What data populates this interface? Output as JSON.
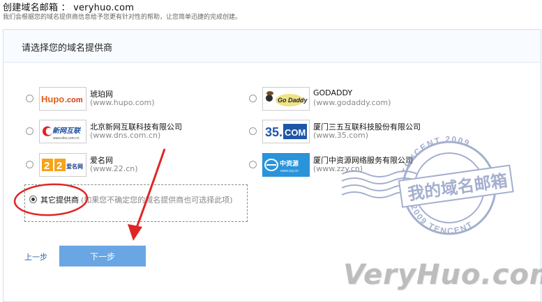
{
  "header": {
    "title": "创建域名邮箱 ： veryhuo.com",
    "subtitle": "我们会根据您的域名提供商信息给予您更有针对性的帮助，让您简单迅捷的完成创建。"
  },
  "panel": {
    "title": "请选择您的域名提供商"
  },
  "providers": [
    {
      "name": "琥珀网",
      "url": "(www.hupo.com)",
      "logo_text": "Hupo.com"
    },
    {
      "name": "GODADDY",
      "url": "(www.godaddy.com)",
      "logo_text": "Go Daddy"
    },
    {
      "name": "北京新网互联科技有限公司",
      "url": "(www.dns.com.cn)",
      "logo_text": "新网互联",
      "logo_sub": "www.dns.com.cn"
    },
    {
      "name": "厦门三五互联科技股份有限公司",
      "url": "(www.35.com)",
      "logo_text": "35.COM"
    },
    {
      "name": "爱名网",
      "url": "(www.22.cn)",
      "logo_text": "22",
      "logo_sub": "爱名网"
    },
    {
      "name": "厦门中资源网络服务有限公司",
      "url": "(www.zzy.cn)",
      "logo_text": "中资源",
      "logo_sub": "www.zzy.cn"
    }
  ],
  "other": {
    "label": "其它提供商",
    "note": "(如果您不确定您的域名提供商也可选择此项)",
    "selected": true
  },
  "buttons": {
    "prev": "上一步",
    "next": "下一步"
  },
  "stamp": {
    "main": "我的域名邮箱",
    "ring_top": "TENCENT 2009",
    "ring_bottom": "2009 TENCENT"
  },
  "watermark": "VeryHuo.com",
  "colors": {
    "accent": "#6aa6e3",
    "link": "#2a6bb0",
    "annotation": "#e02424",
    "stamp": "#5a6fa8"
  }
}
